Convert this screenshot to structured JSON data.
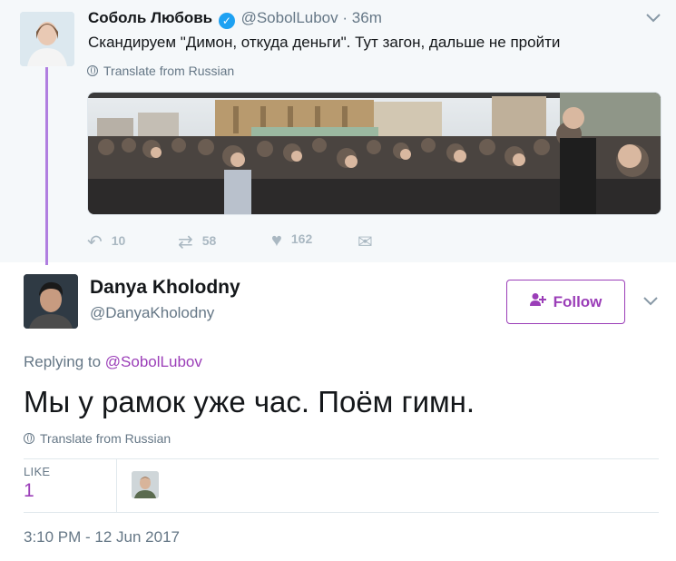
{
  "parent_tweet": {
    "name": "Соболь Любовь",
    "handle": "@SobolLubov",
    "separator": "·",
    "time": "36m",
    "text": "Скандируем \"Димон, откуда деньги\". Тут загон, дальше не пройти",
    "translate": "Translate from Russian",
    "actions": {
      "replies": "10",
      "retweets": "58",
      "likes": "162"
    }
  },
  "tweet": {
    "name": "Danya Kholodny",
    "handle": "@DanyaKholodny",
    "follow_label": "Follow",
    "replying_prefix": "Replying to",
    "replying_to": "@SobolLubov",
    "text": "Мы у рамок уже час. Поём гимн.",
    "translate": "Translate from Russian",
    "like_label": "LIKE",
    "like_count": "1",
    "timestamp": "3:10 PM - 12 Jun 2017"
  },
  "colors": {
    "accent": "#9b3eb8",
    "verified": "#1da1f2",
    "thread_line": "#b07ee0"
  },
  "icons": [
    "verified-badge-icon",
    "chevron-down-icon",
    "globe-icon",
    "reply-icon",
    "retweet-icon",
    "heart-icon",
    "direct-message-icon",
    "follow-person-icon"
  ]
}
